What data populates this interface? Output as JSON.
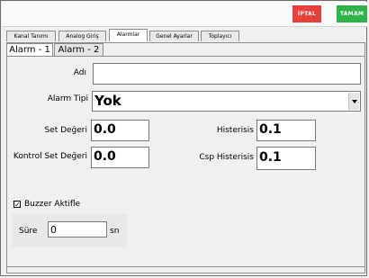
{
  "toolbar": {
    "cancel_label": "İPTAL",
    "ok_label": "TAMAM",
    "cancel_color": "#e8403b",
    "ok_color": "#2fb34a"
  },
  "tabs": [
    {
      "label": "Kanal Tanımı",
      "active": false
    },
    {
      "label": "Analog Giriş",
      "active": false
    },
    {
      "label": "Alarmlar",
      "active": true
    },
    {
      "label": "Genel Ayarlar",
      "active": false
    },
    {
      "label": "Toplayıcı",
      "active": false
    }
  ],
  "subtabs": [
    {
      "label": "Alarm - 1",
      "active": true
    },
    {
      "label": "Alarm - 2",
      "active": false
    }
  ],
  "form": {
    "name_label": "Adı",
    "name_value": "",
    "alarm_type_label": "Alarm Tipi",
    "alarm_type_value": "Yok",
    "set_label": "Set Değeri",
    "set_value": "0.0",
    "hysteresis_label": "Histerisis",
    "hysteresis_value": "0.1",
    "control_set_label": "Kontrol Set Değeri",
    "control_set_value": "0.0",
    "csp_hysteresis_label": "Csp Histerisis",
    "csp_hysteresis_value": "0.1",
    "buzzer_label": "Buzzer Aktifle",
    "buzzer_checked": true,
    "buzzer_check_glyph": "✓",
    "duration_label": "Süre",
    "duration_value": "0",
    "duration_unit": "sn"
  }
}
